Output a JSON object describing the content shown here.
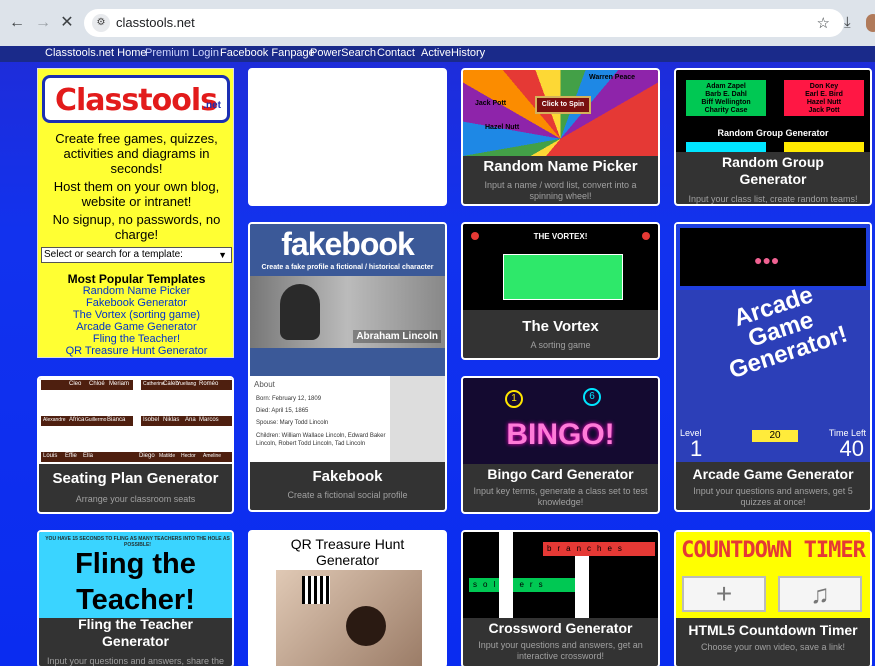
{
  "browser": {
    "url": "classtools.net",
    "back_icon": "arrow-left-icon",
    "forward_icon": "arrow-right-icon",
    "close_icon": "close-icon"
  },
  "topnav": [
    "Classtools.net Home",
    "Premium Login",
    "Facebook Fanpage",
    "PowerSearch",
    "Contact",
    "ActiveHistory"
  ],
  "sidebar": {
    "logo": "Classtools",
    "logo_suffix": ".net",
    "blurb1": "Create free games, quizzes, activities and diagrams in seconds!",
    "blurb2": "Host them on your own blog, website or intranet!",
    "blurb3": "No signup, no passwords, no charge!",
    "select_placeholder": "Select or search for a template:",
    "popular_title": "Most Popular Templates",
    "popular": [
      "Random Name Picker",
      "Fakebook Generator",
      "The Vortex (sorting game)",
      "Arcade Game Generator",
      "Fling the Teacher!",
      "QR Treasure Hunt Generator"
    ]
  },
  "cards": {
    "random_name": {
      "title": "Random Name Picker",
      "desc": "Input a name / word list, convert into a spinning wheel!",
      "spin": "Click to Spin",
      "wheel_names": [
        "Jack Pott",
        "Warren Peace",
        "Hazel Nutt"
      ]
    },
    "random_group": {
      "title": "Random Group Generator",
      "desc": "Input your class list, create random teams!",
      "label": "Random Group Generator",
      "group1": "Adam Zapel\nBarb E. Dahl\nBiff Wellington\nCharity Case",
      "group2": "Don Key\nEarl E. Bird\nHazel Nutt\nJack Pott"
    },
    "vortex": {
      "title": "The Vortex",
      "desc": "A sorting game",
      "banner": "THE VORTEX!"
    },
    "fakebook": {
      "title": "Fakebook",
      "desc": "Create a fictional social profile",
      "logo": "fakebook",
      "tagline": "Create a fake profile a fictional / historical character",
      "name": "Abraham Lincoln",
      "about": "About",
      "facts": [
        "Born: February 12, 1809",
        "Died: April 15, 1865",
        "Spouse: Mary Todd Lincoln",
        "Children: William Wallace Lincoln, Edward Baker Lincoln, Robert Todd Lincoln, Tad Lincoln"
      ]
    },
    "arcade": {
      "title": "Arcade Game Generator",
      "desc": "Input your questions and answers, get 5 quizzes at once!",
      "overlay": "Arcade Game Generator!",
      "level_label": "Level",
      "level": "1",
      "score": "20",
      "time_label": "Time Left",
      "time": "40"
    },
    "seating": {
      "title": "Seating Plan Generator",
      "desc": "Arrange your classroom seats",
      "names": [
        "Cleo",
        "Chloé",
        "Meriam",
        "Catherine",
        "Caleb",
        "Yueliang",
        "Roméo",
        "Alexandre",
        "Africa",
        "Guillermo",
        "Bianca",
        "Isobel",
        "Niklas",
        "Ana",
        "Marcos",
        "Louis",
        "Effie",
        "Ella",
        "Diego",
        "Matilde",
        "Hector",
        "Ameline"
      ]
    },
    "bingo": {
      "title": "Bingo Card Generator",
      "desc": "Input key terms, generate a class set to test knowledge!",
      "word": "BINGO!"
    },
    "fling": {
      "title": "Fling the Teacher Generator",
      "desc": "Input your questions and answers, share the link!",
      "banner": "YOU HAVE 15 SECONDS TO FLING AS MANY TEACHERS INTO THE HOLE AS POSSIBLE!",
      "big": "Fling the Teacher!"
    },
    "qr": {
      "title": "QR Treasure Hunt Generator"
    },
    "crossword": {
      "title": "Crossword Generator",
      "desc": "Input your questions and answers, get an interactive crossword!",
      "across": "branches",
      "down": "soldiers"
    },
    "timer": {
      "title": "HTML5 Countdown Timer",
      "desc": "Choose your own video, save a link!",
      "banner": "COUNTDOWN TIMER"
    }
  }
}
